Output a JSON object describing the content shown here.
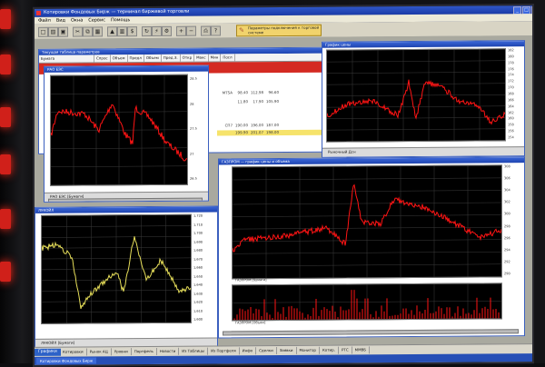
{
  "app": {
    "title": "Котировки Фондовых Бирж — терминал биржевой торговли",
    "menu": [
      "Файл",
      "Вид",
      "Окна",
      "Сервис",
      "Помощь"
    ],
    "toolbar_note": "Параметры подключения к торговой системе"
  },
  "colors": {
    "price_red": "#ff1414",
    "price_yellow": "#e7df5a",
    "plot_bg": "#000000",
    "grid": "#3c3c3c"
  },
  "table": {
    "title": "Текущая таблица параметров",
    "headers": [
      "Бумага",
      "Спрос",
      "Объем",
      "Предл",
      "Объем",
      "Пред.З.",
      "Откр",
      "Макс",
      "Мин",
      "Посл"
    ],
    "rows": [
      [
        "",
        "",
        "",
        "",
        ""
      ],
      [
        "MTSA",
        "98.40",
        "112.98",
        "96.60",
        ""
      ],
      [
        "",
        "11.80",
        "17.90",
        "",
        "105.90"
      ],
      [
        "",
        "",
        "",
        "",
        ""
      ],
      [
        "СП7",
        "190.00",
        "196.00",
        "187.00",
        ""
      ],
      [
        "",
        "199.90",
        "201.07",
        "198.00",
        ""
      ]
    ]
  },
  "charts": {
    "rao": {
      "caption": "РАО ЕЭС [Бумаги]",
      "ticks": [
        "28.5",
        "28",
        "27.5",
        "27",
        "26.5"
      ]
    },
    "ravd": {
      "caption": "Рыночный Дсн",
      "ticks": [
        "182",
        "180",
        "178",
        "176",
        "174",
        "172",
        "170",
        "168",
        "166",
        "164",
        "162",
        "160",
        "158",
        "156",
        "154"
      ]
    },
    "gazprom": {
      "caption": "ГАЗПРОМ [Бумаги]",
      "ticks": [
        "308",
        "306",
        "304",
        "302",
        "300",
        "298",
        "296",
        "294",
        "292",
        "290"
      ]
    },
    "gazvol": {
      "caption": "ГАЗПРОМ [Объем]"
    },
    "lukoil": {
      "caption": "ЛУКОЙЛ [Бумаги]",
      "ticks": [
        "1,720",
        "1,710",
        "1,700",
        "1,690",
        "1,680",
        "1,670",
        "1,660",
        "1,650",
        "1,640",
        "1,630",
        "1,620",
        "1,610",
        "1,600"
      ]
    }
  },
  "task_tabs": [
    "Графики",
    "Котировки",
    "Рынок АЦ",
    "Уровни",
    "Портфель",
    "Новости",
    "Из Таблицы",
    "Из Портфеля",
    "Инфо",
    "Сделки",
    "Заявки",
    "Монитор",
    "Котир.",
    "РТС",
    "ММВБ"
  ],
  "window_buttons": [
    "Котировки Фондовых Бирж"
  ]
}
